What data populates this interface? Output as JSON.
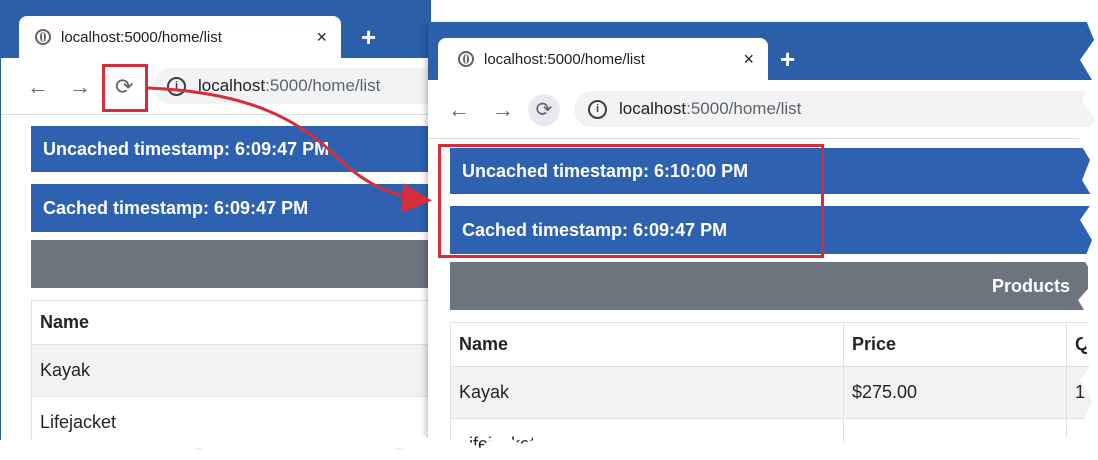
{
  "browser": {
    "tab_title": "localhost:5000/home/list",
    "new_tab": "+",
    "close_tab": "×",
    "address_host": "localhost",
    "address_path": ":5000/home/list",
    "back": "←",
    "forward": "→",
    "reload": "⟳",
    "info": "i"
  },
  "before": {
    "uncached": "Uncached timestamp: 6:09:47 PM",
    "cached": "Cached timestamp: 6:09:47 PM",
    "table": {
      "header": "Name",
      "rows": [
        "Kayak",
        "Lifejacket"
      ]
    }
  },
  "after": {
    "uncached": "Uncached timestamp: 6:10:00 PM",
    "cached": "Cached timestamp: 6:09:47 PM",
    "products_label": "Products",
    "table": {
      "headers": [
        "Name",
        "Price",
        "Q"
      ],
      "row": [
        "Kayak",
        "$275.00",
        "1"
      ],
      "partial_row": "Lifejacket"
    }
  },
  "colors": {
    "accent_blue": "#2e62b0",
    "highlight_red": "#d42e3a",
    "products_grey": "#6c757d"
  }
}
